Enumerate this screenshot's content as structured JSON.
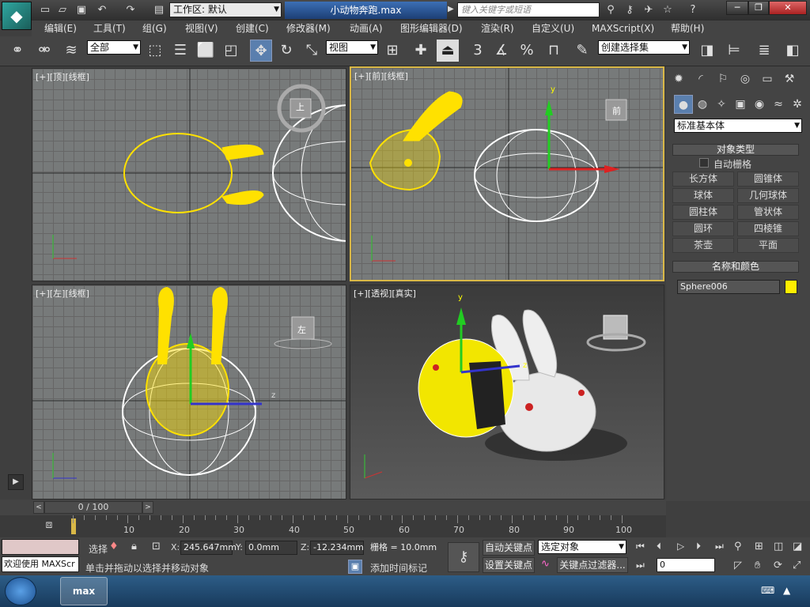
{
  "title_bar": {
    "workspace_label": "工作区: 默认",
    "file_title": "小动物奔跑.max",
    "search_placeholder": "键入关键字或短语"
  },
  "menu": [
    "编辑(E)",
    "工具(T)",
    "组(G)",
    "视图(V)",
    "创建(C)",
    "修改器(M)",
    "动画(A)",
    "图形编辑器(D)",
    "渲染(R)",
    "自定义(U)",
    "MAXScript(X)",
    "帮助(H)"
  ],
  "toolbar": {
    "selection_filter": "全部",
    "ref_coord": "视图",
    "snap_labels": [
      "3",
      "%"
    ],
    "named_selection": "创建选择集"
  },
  "viewports": {
    "top": "[+][顶][线框]",
    "front": "[+][前][线框]",
    "left": "[+][左][线框]",
    "persp": "[+][透视][真实]",
    "viewcube_top": "上",
    "viewcube_front": "前",
    "viewcube_left": "左",
    "axis_labels": {
      "x": "x",
      "y": "y",
      "z": "z"
    }
  },
  "command_panel": {
    "category": "标准基本体",
    "object_type_header": "对象类型",
    "auto_grid": "自动栅格",
    "object_buttons": [
      "长方体",
      "圆锥体",
      "球体",
      "几何球体",
      "圆柱体",
      "管状体",
      "圆环",
      "四棱锥",
      "茶壶",
      "平面"
    ],
    "name_color_header": "名称和颜色",
    "object_name": "Sphere006",
    "object_color": "#ffee00"
  },
  "timeline": {
    "frame_display": "0 / 100",
    "ticks": [
      "10",
      "20",
      "30",
      "40",
      "50",
      "60",
      "70",
      "80",
      "90",
      "100"
    ]
  },
  "status_bar": {
    "welcome": "欢迎使用 MAXScr",
    "selection_label": "选择",
    "x_label": "X:",
    "x_value": "245.647mm",
    "y_label": "Y:",
    "y_value": "0.0mm",
    "z_label": "Z:",
    "z_value": "-12.234mm",
    "grid_value": "栅格 = 10.0mm",
    "prompt": "单击并拖动以选择并移动对象",
    "add_time_tag": "添加时间标记",
    "auto_key": "自动关键点",
    "set_key": "设置关键点",
    "key_mode": "选定对象",
    "key_filter": "关键点过滤器...",
    "current_frame": "0"
  },
  "taskbar": {
    "app_label": "max"
  }
}
